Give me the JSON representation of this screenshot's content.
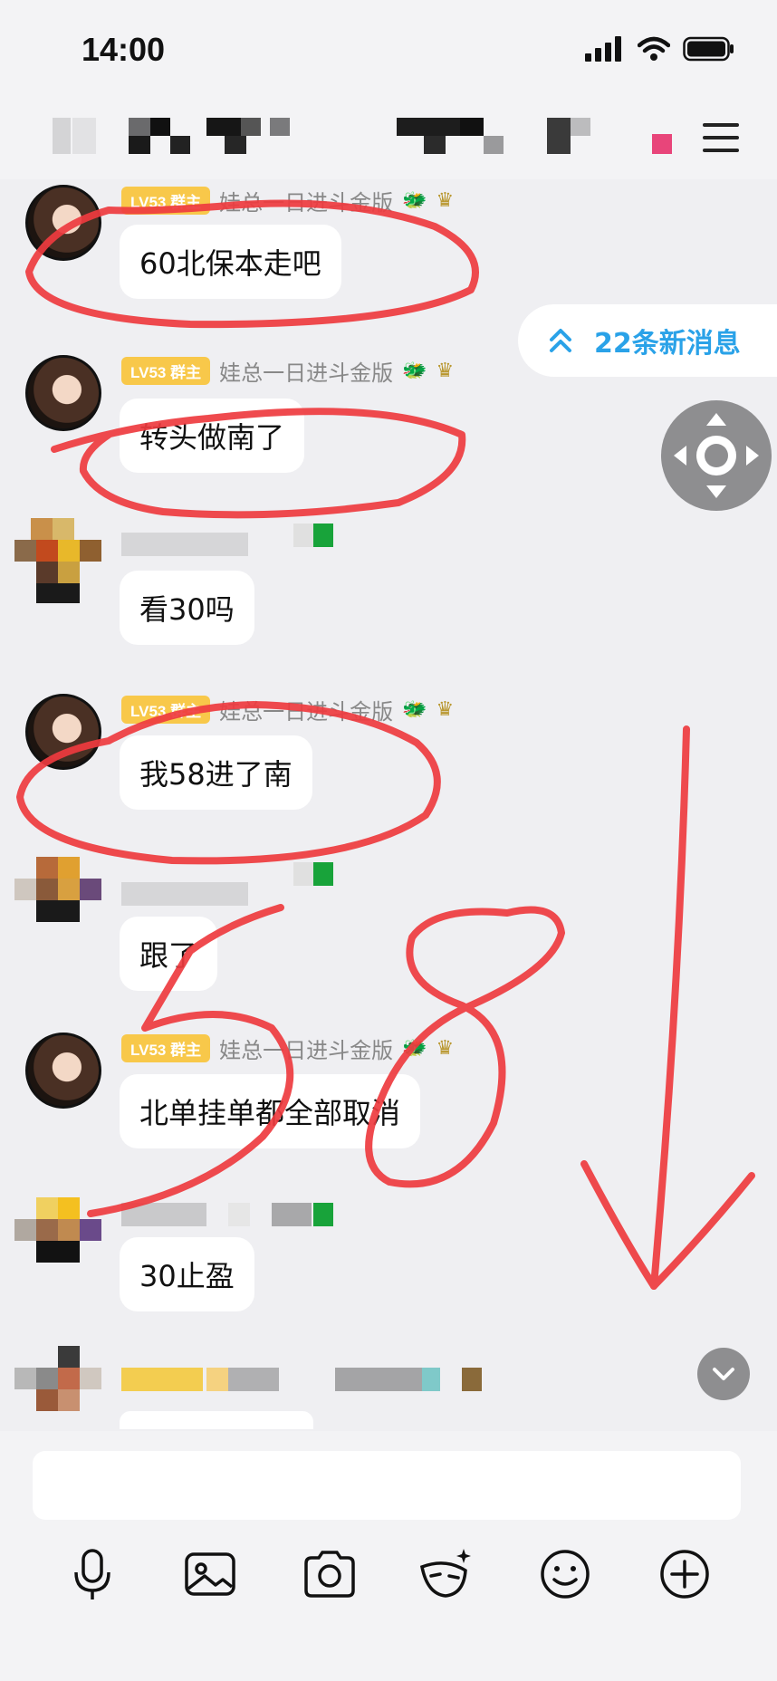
{
  "status_bar": {
    "time": "14:00"
  },
  "new_messages_label": "22条新消息",
  "messages": [
    {
      "level": "LV53",
      "role": "群主",
      "name": "娃总一日进斗金版",
      "text": "60北保本走吧"
    },
    {
      "level": "LV53",
      "role": "群主",
      "name": "娃总一日进斗金版",
      "text": "转头做南了"
    },
    {
      "text": "看30吗"
    },
    {
      "level": "LV53",
      "role": "群主",
      "name": "娃总一日进斗金版",
      "text": "我58进了南"
    },
    {
      "text": "跟了"
    },
    {
      "level": "LV53",
      "role": "群主",
      "name": "娃总一日进斗金版",
      "text": "北单挂单都全部取消"
    },
    {
      "text": "30止盈"
    }
  ],
  "annotation": {
    "handwritten": "58"
  },
  "toolbar": [
    "mic-icon",
    "image-icon",
    "camera-icon",
    "mask-icon",
    "emoji-icon",
    "plus-icon"
  ],
  "colors": {
    "badge": "#f8c84a",
    "accent": "#2aa2e8",
    "annotation": "#ee3b3f"
  }
}
